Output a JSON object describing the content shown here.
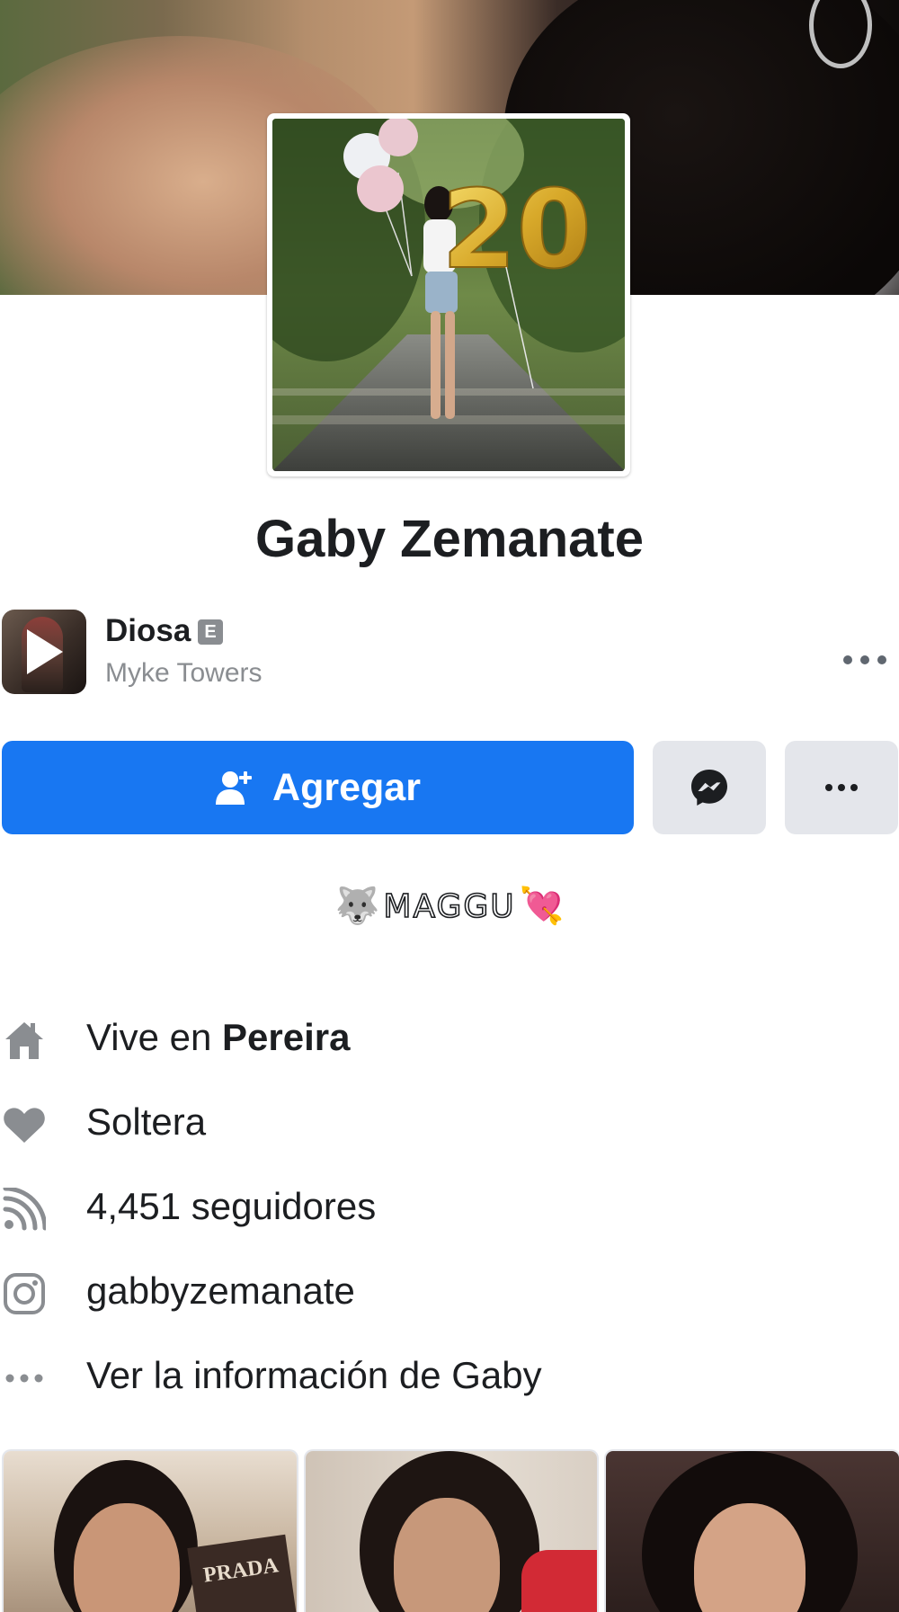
{
  "profile": {
    "name": "Gaby Zemanate",
    "balloon_number": "20"
  },
  "music": {
    "song": "Diosa",
    "explicit_badge": "E",
    "artist": "Myke Towers",
    "more_icon": "more-horizontal-icon"
  },
  "actions": {
    "add_label": "Agregar",
    "add_icon": "add-friend-icon",
    "messenger_icon": "messenger-icon",
    "more_icon": "more-horizontal-icon"
  },
  "bio": {
    "prefix_emoji": "🐺",
    "text": "MAGGU",
    "suffix_emoji": "💘"
  },
  "info": [
    {
      "icon": "home-icon",
      "prefix": "Vive en ",
      "bold": "Pereira"
    },
    {
      "icon": "heart-icon",
      "text": "Soltera"
    },
    {
      "icon": "rss-feed-icon",
      "text": "4,451 seguidores"
    },
    {
      "icon": "instagram-icon",
      "text": "gabbyzemanate"
    },
    {
      "icon": "more-horizontal-icon",
      "text": "Ver la información de Gaby"
    }
  ],
  "photo_strip_overlay": "PRADA",
  "colors": {
    "primary_button": "#1877f2",
    "secondary_button": "#e4e6eb",
    "text_primary": "#1c1e21",
    "text_secondary": "#8a8d91",
    "icon_gray": "#8a8d91"
  }
}
